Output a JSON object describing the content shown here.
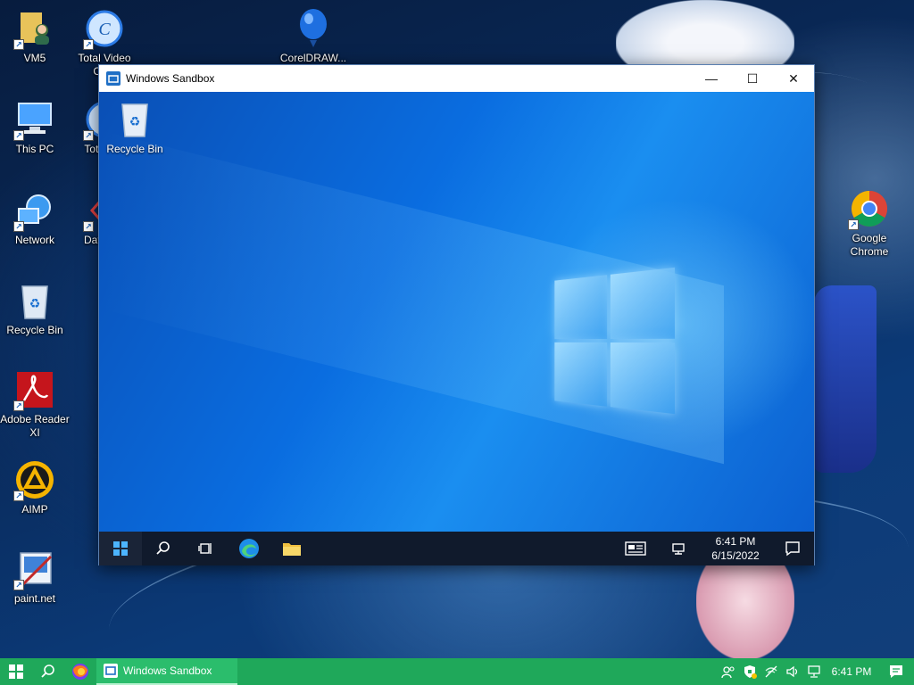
{
  "desktop": {
    "icons": [
      {
        "label": "VM5"
      },
      {
        "label": "Total Video Co..."
      },
      {
        "label": "CorelDRAW..."
      },
      {
        "label": "This PC"
      },
      {
        "label": "Total P..."
      },
      {
        "label": "Network"
      },
      {
        "label": "DataW..."
      },
      {
        "label": "Recycle Bin"
      },
      {
        "label": "Adobe Reader XI"
      },
      {
        "label": "AIMP"
      },
      {
        "label": "paint.net"
      },
      {
        "label": "Google Chrome"
      }
    ]
  },
  "sandbox": {
    "title": "Windows Sandbox",
    "controls": {
      "minimize": "—",
      "maximize": "☐",
      "close": "✕"
    },
    "desktop_icon": {
      "label": "Recycle Bin"
    },
    "taskbar": {
      "time": "6:41 PM",
      "date": "6/15/2022"
    }
  },
  "host_taskbar": {
    "active_app": "Windows Sandbox",
    "time": "6:41 PM"
  },
  "colors": {
    "host_taskbar": "#1fa85a",
    "sandbox_accent": "#0a6de0"
  }
}
